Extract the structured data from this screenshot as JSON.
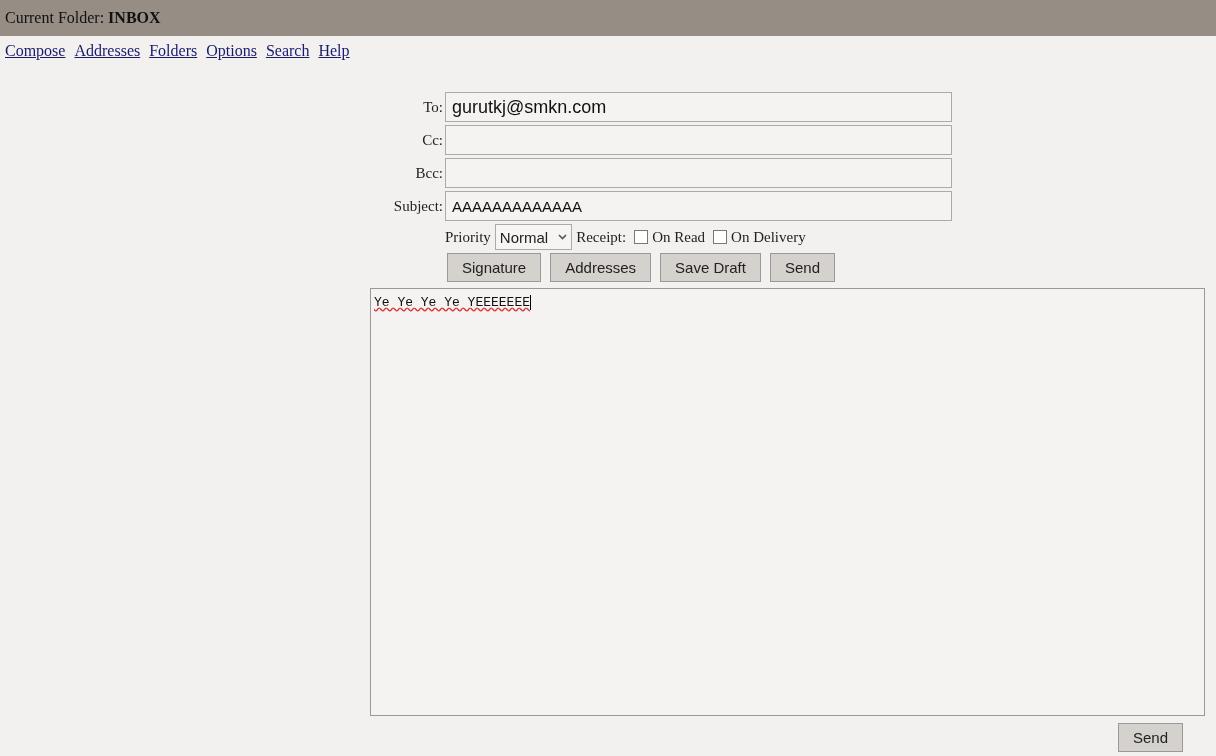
{
  "header": {
    "label": "Current Folder:",
    "folder": "INBOX"
  },
  "nav_links": [
    "Compose",
    "Addresses",
    "Folders",
    "Options",
    "Search",
    "Help"
  ],
  "fields": [
    {
      "label": "To:",
      "value": "gurutkj@smkn.com"
    },
    {
      "label": "Cc:"
    },
    {
      "label": "Bcc:"
    },
    {
      "label": "Subject:",
      "value": "AAAAAAAAAAAAA"
    }
  ],
  "priority": {
    "label": "Priority",
    "value": "Normal"
  },
  "receipt": {
    "label": "Receipt:",
    "options": [
      {
        "label": "On Read",
        "checked": false
      },
      {
        "label": "On Delivery",
        "checked": false
      }
    ]
  },
  "buttons": [
    "Signature",
    "Addresses",
    "Save Draft",
    "Send"
  ],
  "body": "Ye Ye Ye Ye YEEEEEEE",
  "bottom_button": "Send"
}
